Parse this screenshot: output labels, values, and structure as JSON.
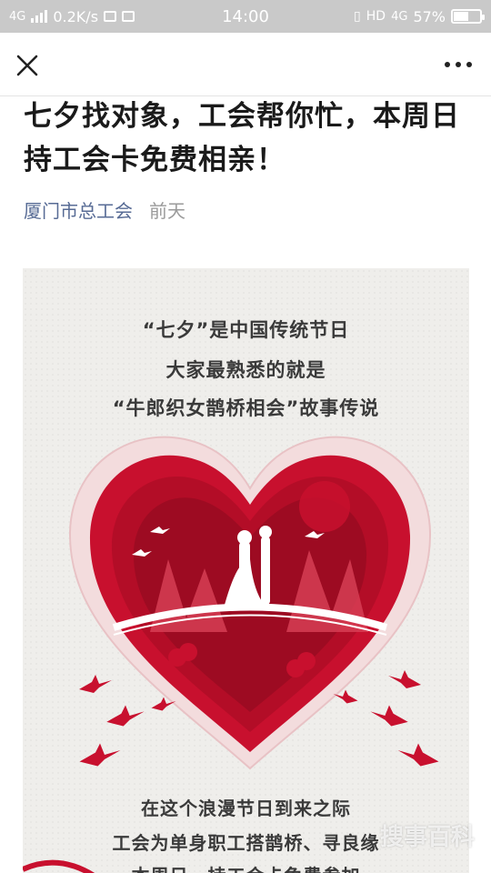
{
  "status_bar": {
    "network": "4G",
    "speed": "0.2K/s",
    "time": "14:00",
    "hd": "HD",
    "network_right": "4G",
    "battery": "57%",
    "battery_level": 0.57
  },
  "nav": {
    "close_icon": "close-icon",
    "more_icon": "more-dots-icon"
  },
  "article": {
    "title": "七夕找对象，工会帮你忙，本周日持工会卡免费相亲！",
    "author": "厦门市总工会",
    "date": "前天"
  },
  "poster": {
    "lines_top": [
      "“七夕”是中国传统节日",
      "大家最熟悉的就是",
      "“牛郎织女鹊桥相会”故事传说"
    ],
    "lines_bottom": [
      "在这个浪漫节日到来之际",
      "工会为单身职工搭鹊桥、寻良缘",
      "本周日，持工会卡免费参加"
    ],
    "colors": {
      "heart_outer": "#e8c2c5",
      "heart_red": "#c8102e",
      "heart_dark": "#9d0b22",
      "background": "#efeeeb"
    }
  },
  "watermark": "搜事百科"
}
